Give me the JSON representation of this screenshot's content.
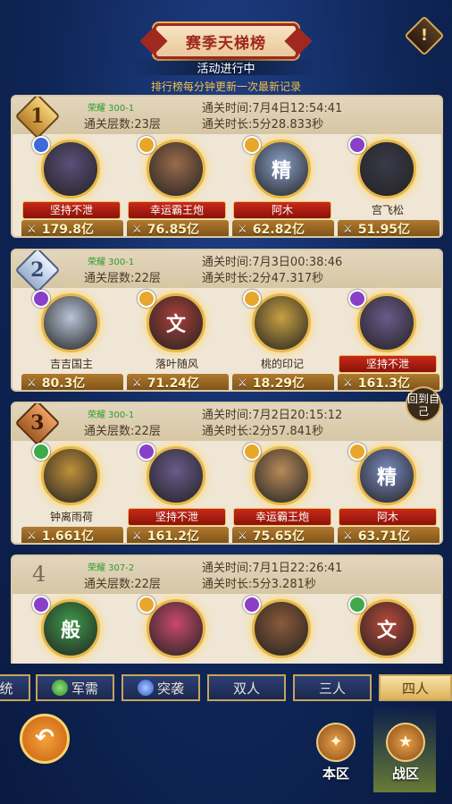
{
  "header": {
    "title": "赛季天梯榜",
    "status": "活动进行中",
    "notice": "排行榜每分钟更新一次最新记录",
    "alert_icon": "!"
  },
  "return_self": "回到自己",
  "cards": [
    {
      "rank": "1",
      "glory": "荣耀  300-1",
      "layers": "通关层数:23层",
      "time": "通关时间:7月4日12:54:41",
      "duration": "通关时长:5分28.833秒",
      "members": [
        {
          "name": "坚持不泄",
          "power": "179.8亿",
          "faction": "blue",
          "ribbon": "red"
        },
        {
          "name": "幸运霸王炮",
          "power": "76.85亿",
          "faction": "gold",
          "ribbon": "red"
        },
        {
          "name": "阿木",
          "power": "62.82亿",
          "faction": "gold",
          "ribbon": "red",
          "glyph": "精"
        },
        {
          "name": "宫飞松",
          "power": "51.95亿",
          "faction": "purple",
          "ribbon": "plain"
        }
      ]
    },
    {
      "rank": "2",
      "glory": "荣耀  300-1",
      "layers": "通关层数:22层",
      "time": "通关时间:7月3日00:38:46",
      "duration": "通关时长:2分47.317秒",
      "members": [
        {
          "name": "吉吉国主",
          "power": "80.3亿",
          "faction": "purple",
          "ribbon": "plain"
        },
        {
          "name": "落叶随风",
          "power": "71.24亿",
          "faction": "gold",
          "ribbon": "plain",
          "glyph": "文"
        },
        {
          "name": "桃的印记",
          "power": "18.29亿",
          "faction": "gold",
          "ribbon": "plain"
        },
        {
          "name": "坚持不泄",
          "power": "161.3亿",
          "faction": "purple",
          "ribbon": "red"
        }
      ]
    },
    {
      "rank": "3",
      "glory": "荣耀  300-1",
      "layers": "通关层数:22层",
      "time": "通关时间:7月2日20:15:12",
      "duration": "通关时长:2分57.841秒",
      "members": [
        {
          "name": "钟离雨荷",
          "power": "1.661亿",
          "faction": "green",
          "ribbon": "plain"
        },
        {
          "name": "坚持不泄",
          "power": "161.2亿",
          "faction": "purple",
          "ribbon": "red"
        },
        {
          "name": "幸运霸王炮",
          "power": "75.65亿",
          "faction": "gold",
          "ribbon": "red"
        },
        {
          "name": "阿木",
          "power": "63.71亿",
          "faction": "gold",
          "ribbon": "red",
          "glyph": "精"
        }
      ]
    },
    {
      "rank": "4",
      "glory": "荣耀  307-2",
      "layers": "通关层数:22层",
      "time": "通关时间:7月1日22:26:41",
      "duration": "通关时长:5分3.281秒",
      "members": [
        {
          "name": "",
          "power": "",
          "faction": "purple",
          "ribbon": "plain",
          "glyph": "般"
        },
        {
          "name": "",
          "power": "",
          "faction": "gold",
          "ribbon": "plain"
        },
        {
          "name": "",
          "power": "",
          "faction": "purple",
          "ribbon": "plain"
        },
        {
          "name": "",
          "power": "",
          "faction": "green",
          "ribbon": "plain",
          "glyph": "文"
        }
      ]
    }
  ],
  "filters": [
    {
      "label": "统",
      "icon": ""
    },
    {
      "label": "军需",
      "icon": "green-gem"
    },
    {
      "label": "突袭",
      "icon": "blue-gem"
    },
    {
      "label": "双人",
      "icon": ""
    },
    {
      "label": "三人",
      "icon": ""
    },
    {
      "label": "四人",
      "icon": "",
      "active": true
    }
  ],
  "bottom": {
    "back_icon": "↶",
    "local_zone": "本区",
    "war_zone": "战区",
    "local_glyph": "✦",
    "war_glyph": "★"
  },
  "colors": {
    "accent_red": "#a0281f",
    "gold": "#e6b84a",
    "card_bg": "#efe6d6",
    "glory_green": "#2e9b2e"
  }
}
